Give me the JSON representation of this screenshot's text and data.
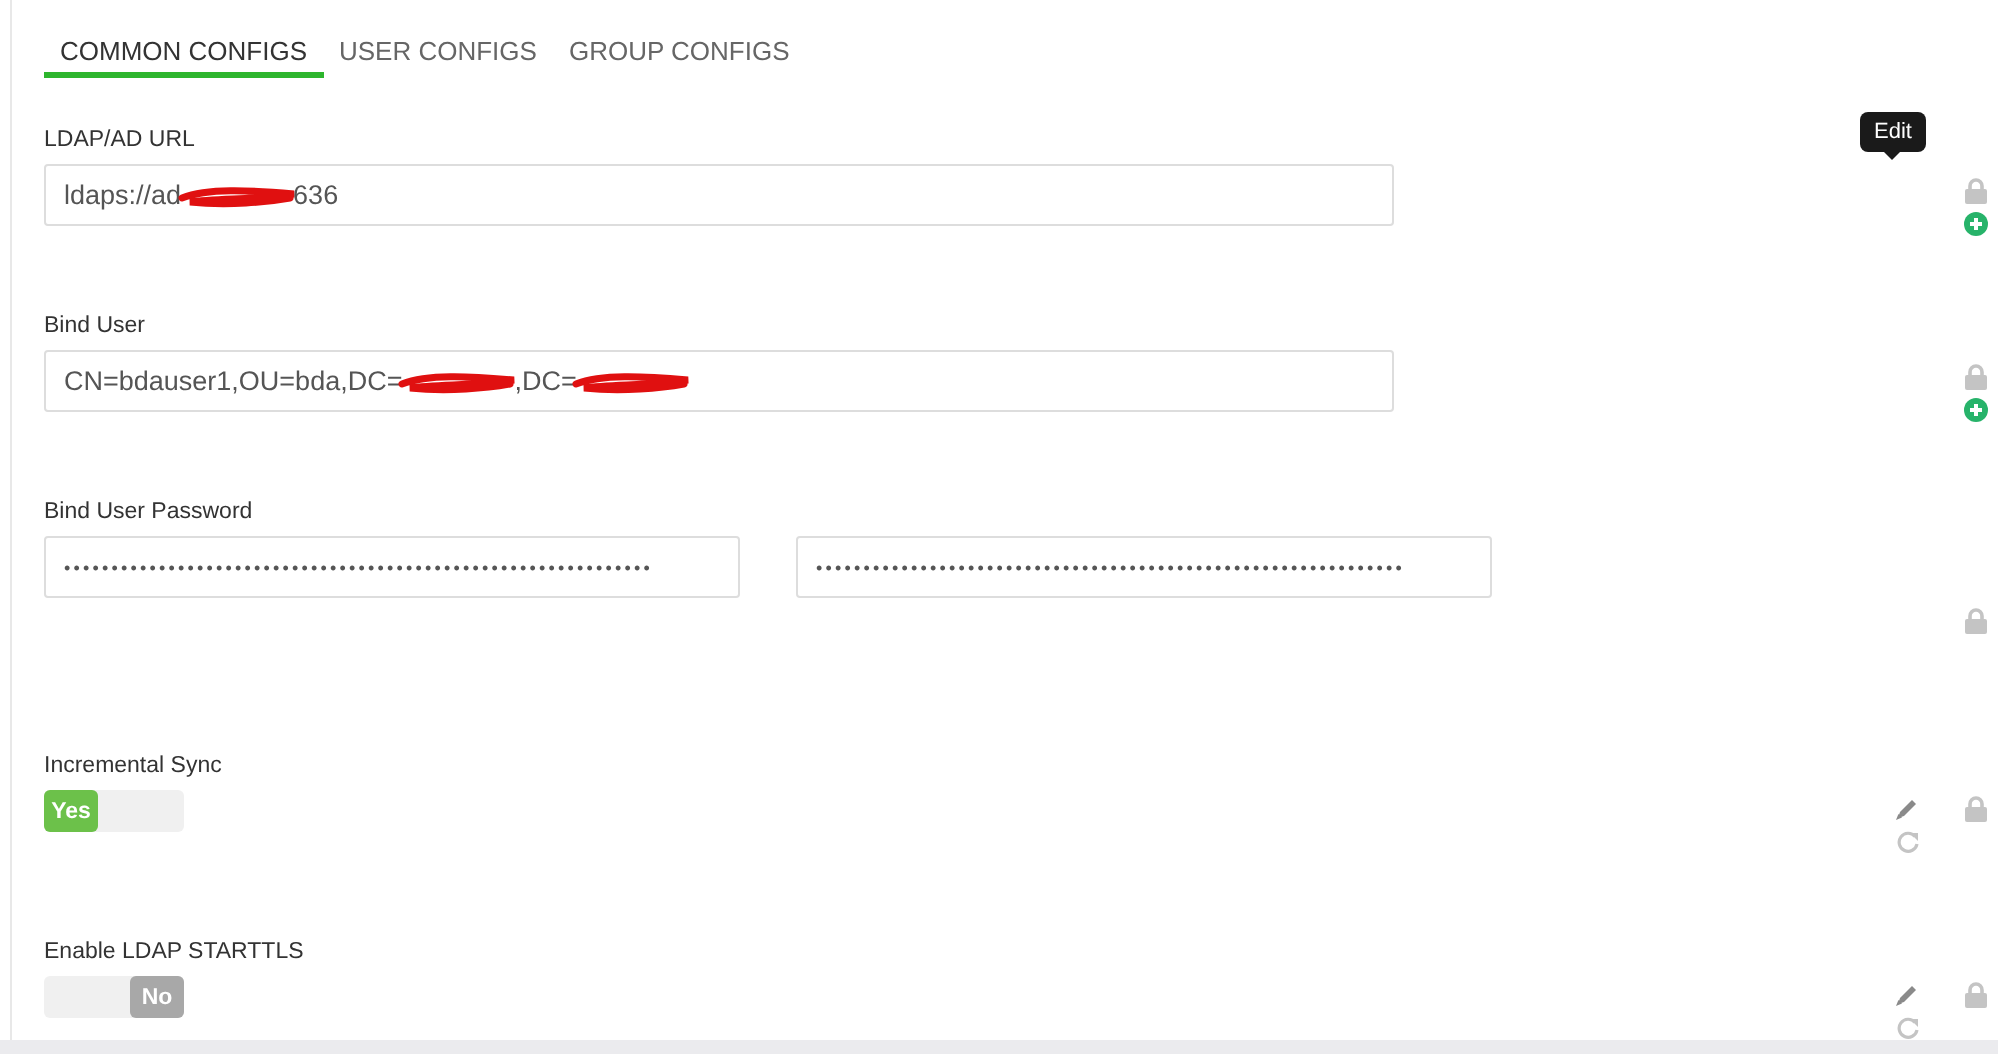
{
  "tabs": [
    {
      "label": "COMMON CONFIGS",
      "selected": true
    },
    {
      "label": "USER CONFIGS",
      "selected": false
    },
    {
      "label": "GROUP CONFIGS",
      "selected": false
    }
  ],
  "fields": [
    {
      "kind": "text",
      "label": "LDAP/AD URL",
      "tooltip": "Edit",
      "value": [
        {
          "kind": "text",
          "text": "ldaps://ad"
        },
        {
          "kind": "redaction"
        },
        {
          "kind": "text",
          "text": "636"
        }
      ],
      "actions": [
        {
          "kind": "lock"
        },
        {
          "kind": "add"
        }
      ]
    },
    {
      "kind": "text",
      "label": "Bind User",
      "value": [
        {
          "kind": "text",
          "text": "CN=bdauser1,OU=bda,DC="
        },
        {
          "kind": "redaction"
        },
        {
          "kind": "text",
          "text": ",DC="
        },
        {
          "kind": "redaction"
        }
      ],
      "actions": [
        {
          "kind": "lock"
        },
        {
          "kind": "add"
        }
      ]
    },
    {
      "kind": "password",
      "label": "Bind User Password",
      "values": [
        "••••••••••••••••••••••••••••••••••••••••••••••••••••••••••••••",
        "••••••••••••••••••••••••••••••••••••••••••••••••••••••••••••••"
      ],
      "actions": [
        {
          "kind": "lock"
        }
      ]
    },
    {
      "kind": "toggle",
      "label": "Incremental Sync",
      "on": true,
      "on_text": "Yes",
      "actions": [
        {
          "kind": "edit"
        },
        {
          "kind": "reset"
        },
        {
          "kind": "lock"
        }
      ]
    },
    {
      "kind": "toggle",
      "label": "Enable LDAP STARTTLS",
      "on": false,
      "off_text": "No",
      "actions": [
        {
          "kind": "edit"
        },
        {
          "kind": "reset"
        },
        {
          "kind": "lock"
        }
      ]
    }
  ]
}
